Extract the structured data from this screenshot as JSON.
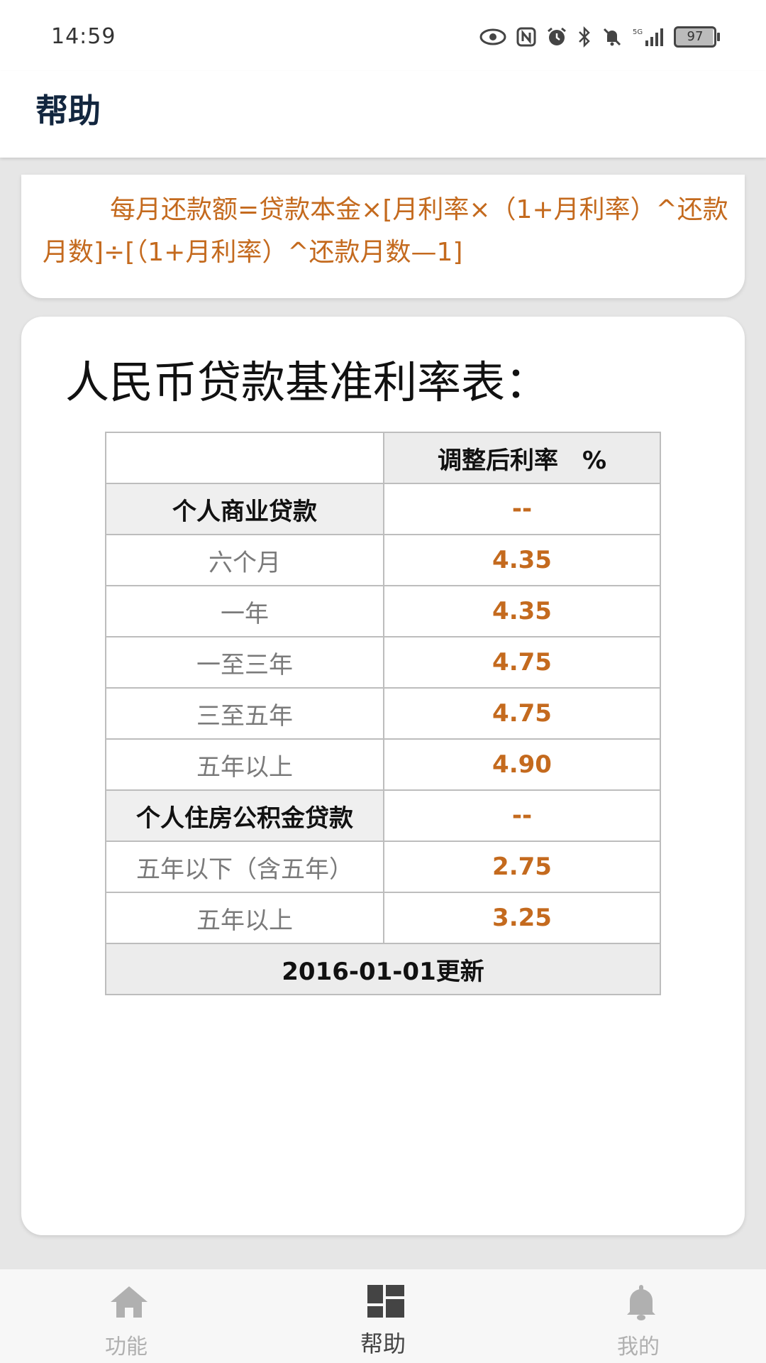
{
  "status_bar": {
    "time": "14:59",
    "battery": "97",
    "icons": [
      "eye-icon",
      "nfc-icon",
      "alarm-icon",
      "bluetooth-icon",
      "mute-icon",
      "signal-5g-icon",
      "battery-icon"
    ]
  },
  "header": {
    "title": "帮助"
  },
  "formula": {
    "text": "每月还款额=贷款本金×[月利率×（1+月利率）^还款月数]÷[（1+月利率）^还款月数—1]"
  },
  "rate_table": {
    "title": "人民币贷款基准利率表：",
    "column_header": "调整后利率　%",
    "sections": [
      {
        "category": "个人商业贷款",
        "category_value": "--",
        "rows": [
          {
            "term": "六个月",
            "rate": "4.35"
          },
          {
            "term": "一年",
            "rate": "4.35"
          },
          {
            "term": "一至三年",
            "rate": "4.75"
          },
          {
            "term": "三至五年",
            "rate": "4.75"
          },
          {
            "term": "五年以上",
            "rate": "4.90"
          }
        ]
      },
      {
        "category": "个人住房公积金贷款",
        "category_value": "--",
        "rows": [
          {
            "term": "五年以下（含五年）",
            "rate": "2.75"
          },
          {
            "term": "五年以上",
            "rate": "3.25"
          }
        ]
      }
    ],
    "footer": "2016-01-01更新"
  },
  "bottom_nav": {
    "items": [
      {
        "label": "功能",
        "icon": "home-icon",
        "active": false
      },
      {
        "label": "帮助",
        "icon": "dashboard-icon",
        "active": true
      },
      {
        "label": "我的",
        "icon": "bell-icon",
        "active": false
      }
    ]
  },
  "colors": {
    "accent": "#c46a1e",
    "title": "#12263f"
  }
}
